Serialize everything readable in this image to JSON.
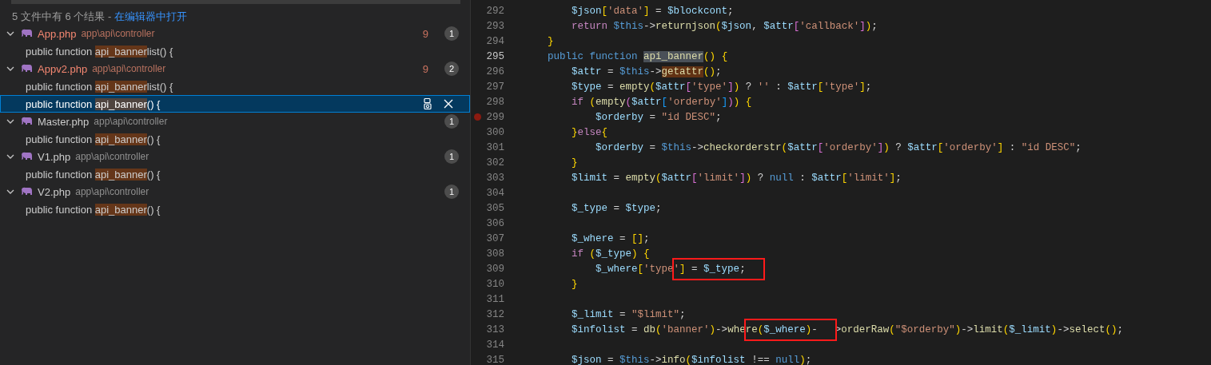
{
  "search_summary": {
    "text": "5 文件中有 6 个结果 - ",
    "link": "在编辑器中打开"
  },
  "results": [
    {
      "file": "App.php",
      "path": "app\\api\\controller",
      "expanded": true,
      "has_errors": true,
      "problems": "9",
      "count": "1",
      "matches": [
        {
          "before": "public function ",
          "match": "api_banner",
          "after": "list() {",
          "selected": false
        }
      ]
    },
    {
      "file": "Appv2.php",
      "path": "app\\api\\controller",
      "expanded": true,
      "has_errors": true,
      "problems": "9",
      "count": "2",
      "matches": [
        {
          "before": "public function ",
          "match": "api_banner",
          "after": "list() {",
          "selected": false
        },
        {
          "before": "public function ",
          "match": "api_banner",
          "after": "() {",
          "selected": true
        }
      ]
    },
    {
      "file": "Master.php",
      "path": "app\\api\\controller",
      "expanded": true,
      "has_errors": false,
      "count": "1",
      "matches": [
        {
          "before": "public function ",
          "match": "api_banner",
          "after": "() {",
          "selected": false
        }
      ]
    },
    {
      "file": "V1.php",
      "path": "app\\api\\controller",
      "expanded": true,
      "has_errors": false,
      "count": "1",
      "matches": [
        {
          "before": "public function ",
          "match": "api_banner",
          "after": "() {",
          "selected": false
        }
      ]
    },
    {
      "file": "V2.php",
      "path": "app\\api\\controller",
      "expanded": true,
      "has_errors": false,
      "count": "1",
      "matches": [
        {
          "before": "public function ",
          "match": "api_banner",
          "after": "() {",
          "selected": false
        }
      ]
    }
  ],
  "editor": {
    "lines": [
      {
        "number": "292",
        "current": false,
        "parts": [
          {
            "text": "        $json['data'] = $blockcont;"
          }
        ]
      },
      {
        "number": "293",
        "current": false,
        "parts": [
          {
            "text": "        return $this->returnjson($json, $attr['callback']);"
          }
        ]
      },
      {
        "number": "294",
        "current": false,
        "parts": [
          {
            "text": "    }"
          }
        ]
      },
      {
        "number": "295",
        "current": true,
        "parts": [
          {
            "text": "    public function "
          },
          {
            "text": "api_banner",
            "selection": true
          },
          {
            "text": "() {"
          }
        ]
      },
      {
        "number": "296",
        "current": false,
        "parts": [
          {
            "text": "        $attr = $this->"
          },
          {
            "text": "getattr",
            "match": true
          },
          {
            "text": "();"
          }
        ]
      },
      {
        "number": "297",
        "current": false,
        "parts": [
          {
            "text": "        $type = empty($attr['type']) ? '' : $attr['type'];"
          }
        ]
      },
      {
        "number": "298",
        "current": false,
        "parts": [
          {
            "text": "        if (empty($attr['orderby'])) {"
          }
        ]
      },
      {
        "number": "299",
        "current": false,
        "breakpoint": true,
        "parts": [
          {
            "text": "            $orderby = \"id DESC\";"
          }
        ]
      },
      {
        "number": "300",
        "current": false,
        "parts": [
          {
            "text": "        }else{"
          }
        ]
      },
      {
        "number": "301",
        "current": false,
        "parts": [
          {
            "text": "            $orderby = $this->checkorderstr($attr['orderby']) ? $attr['orderby'] : \"id DESC\";"
          }
        ]
      },
      {
        "number": "302",
        "current": false,
        "parts": [
          {
            "text": "        }"
          }
        ]
      },
      {
        "number": "303",
        "current": false,
        "parts": [
          {
            "text": "        $limit = empty($attr['limit']) ? null : $attr['limit'];"
          }
        ]
      },
      {
        "number": "304",
        "current": false
      },
      {
        "number": "305",
        "current": false,
        "parts": [
          {
            "text": "        $_type = $type;"
          }
        ]
      },
      {
        "number": "306",
        "current": false
      },
      {
        "number": "307",
        "current": false,
        "parts": [
          {
            "text": "        $_where = [];"
          }
        ]
      },
      {
        "number": "308",
        "current": false,
        "parts": [
          {
            "text": "        if ($_type) {"
          }
        ]
      },
      {
        "number": "309",
        "current": false,
        "parts": [
          {
            "text": "            $_where['type"
          },
          {
            "text": "'] = $_type;",
            "boxed": true
          }
        ]
      },
      {
        "number": "310",
        "current": false,
        "parts": [
          {
            "text": "        }"
          }
        ]
      },
      {
        "number": "311",
        "current": false
      },
      {
        "number": "312",
        "current": false,
        "parts": [
          {
            "text": "        $_limit = \"$limit\";"
          }
        ]
      },
      {
        "number": "313",
        "current": false,
        "parts": [
          {
            "text": "        $infolist = db('banner')->whe"
          },
          {
            "text": "re($_where)-",
            "boxed": true
          },
          {
            "text": ">orderRaw(\"$orderby\")->limit($_limit)->select();"
          }
        ]
      },
      {
        "number": "314",
        "current": false
      },
      {
        "number": "315",
        "current": false,
        "parts": [
          {
            "text": "        $json = $this->info($infolist !== null);"
          }
        ]
      }
    ]
  }
}
